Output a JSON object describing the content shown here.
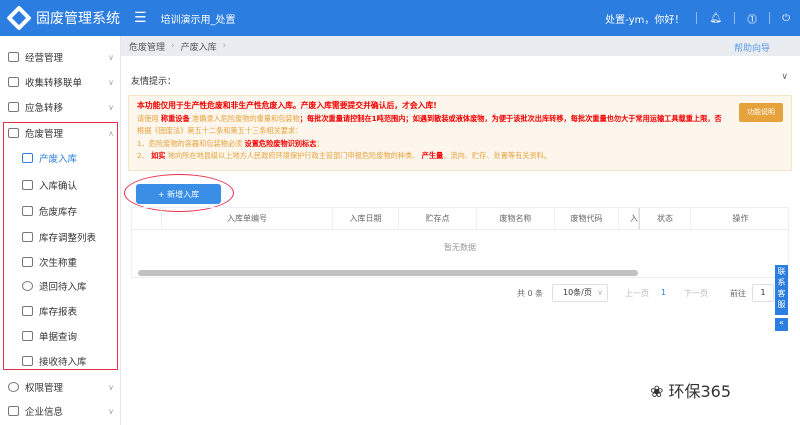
{
  "header": {
    "title": "固废管理系统",
    "org": "培训演示用_处置",
    "greeting": "处置-ym，你好！"
  },
  "sidebar": {
    "items": [
      {
        "label": "经营管理"
      },
      {
        "label": "收集转移联单"
      },
      {
        "label": "应急转移"
      },
      {
        "label": "危废管理"
      },
      {
        "label": "权限管理"
      },
      {
        "label": "企业信息"
      }
    ],
    "sub_items": [
      {
        "label": "产废入库"
      },
      {
        "label": "入库确认"
      },
      {
        "label": "危废库存"
      },
      {
        "label": "库存调整列表"
      },
      {
        "label": "次生称重"
      },
      {
        "label": "退回待入库"
      },
      {
        "label": "库存报表"
      },
      {
        "label": "单据查询"
      },
      {
        "label": "接收待入库"
      }
    ]
  },
  "breadcrumb": [
    "危废管理",
    "产废入库"
  ],
  "help_label": "帮助向导",
  "tip_label": "友情提示：",
  "notice": {
    "line1": "本功能仅用于生产性危废和非生产性危废入库。产废入库需要提交并确认后，才会入库!",
    "line2a": "请使用",
    "line2b": "称重设备",
    "line2c": "准确录入危险废物的重量和包装物",
    "line2d": "；每批次重量请控制在1吨范围内；如遇到散装或液体废物，为便于该批次出库转移，每批次重量也勿大于常用运输工具载重上限，否",
    "line3": "根据《固废法》第五十二条和第五十三条相关要求：",
    "line4a": "1、危险废物的容器和包装物必须",
    "line4b": "设置危险废物识别标志",
    "line4c": "；",
    "line5a": "2、",
    "line5b": "如实",
    "line5c": "地向所在地县级以上地方人民政府环境保护行政主管部门申报危险废物的种类、",
    "line5d": "产生量",
    "line5e": "、流向、贮存、处置等有关资料。",
    "button": "功能说明"
  },
  "add_button": "+ 新增入库",
  "table": {
    "columns": [
      "入库单编号",
      "入库日期",
      "贮存点",
      "废物名称",
      "废物代码",
      "入",
      "状态",
      "操作"
    ],
    "empty": "暂无数据"
  },
  "pagination": {
    "total": "共 0 条",
    "page_size": "10条/页",
    "prev": "上一页",
    "current": "1",
    "next": "下一页",
    "goto_label": "前往",
    "goto_value": "1"
  },
  "customer_service": "联系客服",
  "watermark": "环保365"
}
